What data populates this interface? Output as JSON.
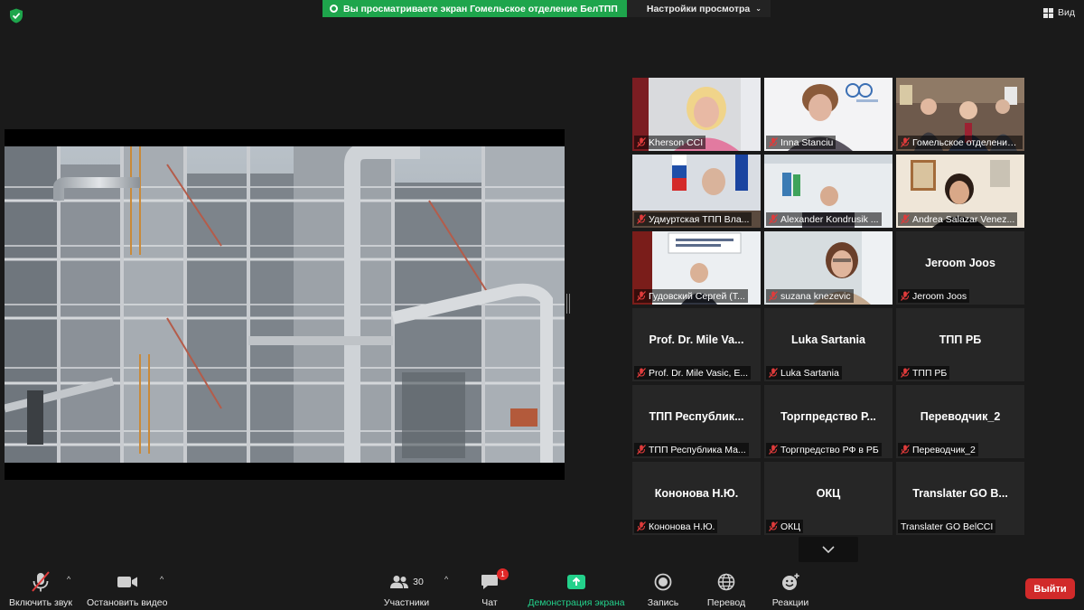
{
  "top": {
    "share_text": "Вы просматриваете экран Гомельское отделение БелТПП",
    "view_options": "Настройки просмотра",
    "view_button": "Вид"
  },
  "participants": [
    {
      "caption": "Kherson CCI",
      "video": "woman-blonde"
    },
    {
      "caption": "Inna Stanciu",
      "video": "woman-logo"
    },
    {
      "caption": "Гомельское отделение ...",
      "video": "room-group",
      "active": true
    },
    {
      "caption": "Удмуртская ТПП Вла...",
      "video": "man-flags"
    },
    {
      "caption": "Alexander Kondrusik ...",
      "video": "man-office"
    },
    {
      "caption": "Andrea Salazar Venez...",
      "video": "woman-dark"
    },
    {
      "caption": "Гудовский Сергей (Т...",
      "video": "man-sign"
    },
    {
      "caption": "suzana knezevic",
      "video": "woman-brown"
    },
    {
      "caption": "Jeroom Joos",
      "name": "Jeroom Joos"
    },
    {
      "caption": "Prof. Dr. Mile Vasic, E...",
      "name": "Prof. Dr. Mile Va..."
    },
    {
      "caption": "Luka Sartania",
      "name": "Luka Sartania"
    },
    {
      "caption": "ТПП РБ",
      "name": "ТПП РБ"
    },
    {
      "caption": "ТПП Республика Ма...",
      "name": "ТПП Республик..."
    },
    {
      "caption": "Торгпредство РФ в РБ",
      "name": "Торгпредство Р..."
    },
    {
      "caption": "Переводчик_2",
      "name": "Переводчик_2"
    },
    {
      "caption": "Кононова Н.Ю.",
      "name": "Кононова Н.Ю."
    },
    {
      "caption": "ОКЦ",
      "name": "ОКЦ"
    },
    {
      "caption": "Translater GO BelCCI",
      "name": "Translater GO B...",
      "unmuted": true
    }
  ],
  "toolbar": {
    "mute_label": "Включить звук",
    "video_label": "Остановить видео",
    "participants_label": "Участники",
    "participants_count": "30",
    "chat_label": "Чат",
    "chat_badge": "1",
    "share_label": "Демонстрация экрана",
    "record_label": "Запись",
    "translate_label": "Перевод",
    "reactions_label": "Реакции",
    "leave_label": "Выйти"
  },
  "colors": {
    "share_green": "#1ea54c",
    "active_speaker": "#c7dc45",
    "leave_red": "#d12a2a",
    "muted_red": "#e03b3b"
  }
}
